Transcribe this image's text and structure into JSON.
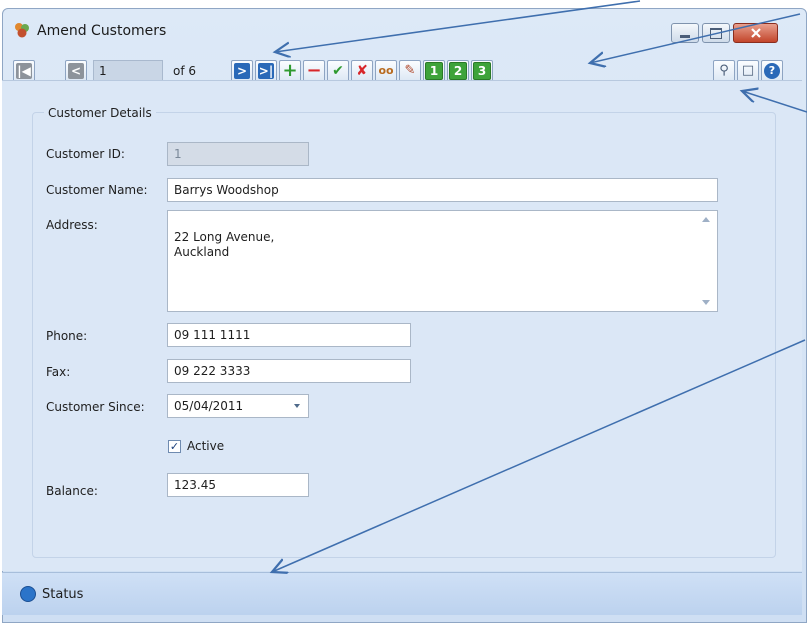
{
  "window": {
    "title": "Amend Customers"
  },
  "toolbar": {
    "record_number": "1",
    "of_label": "of 6",
    "num_buttons": [
      "1",
      "2",
      "3"
    ]
  },
  "form": {
    "group_title": "Customer Details",
    "customer_id_label": "Customer ID:",
    "customer_id_value": "1",
    "customer_name_label": "Customer Name:",
    "customer_name_value": "Barrys Woodshop",
    "address_label": "Address:",
    "address_value": "22 Long Avenue,\nAuckland",
    "phone_label": "Phone:",
    "phone_value": "09 111 1111",
    "fax_label": "Fax:",
    "fax_value": "09 222 3333",
    "customer_since_label": "Customer Since:",
    "customer_since_value": "05/04/2011",
    "active_label": "Active",
    "active_checked": true,
    "balance_label": "Balance:",
    "balance_value": "123.45"
  },
  "statusbar": {
    "label": "Status"
  },
  "colors": {
    "annotation_arrow": "#3f6fae",
    "accent_blue": "#2a69b8",
    "green_button": "#3ea33a",
    "delete_red": "#d8262a"
  }
}
